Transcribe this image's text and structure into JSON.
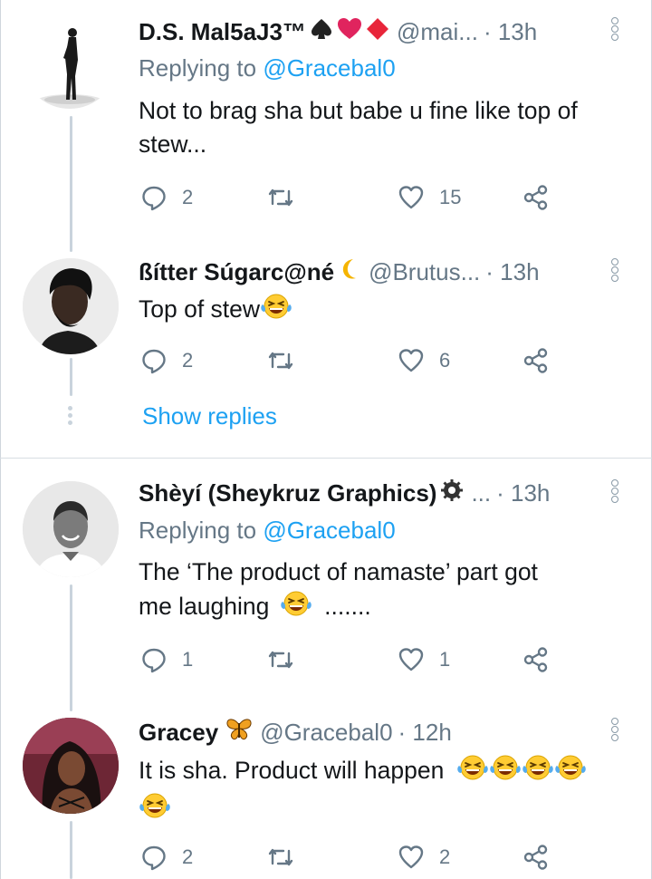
{
  "tweets": [
    {
      "name": "D.S. Mal5aJ3™",
      "name_emojis": [
        "spade",
        "heart",
        "diamond"
      ],
      "handle": "@mai...",
      "time": "· 13h",
      "replying_prefix": "Replying to",
      "replying_handle": "@Gracebal0",
      "text": "Not to brag sha but babe u fine like top of stew...",
      "replies": "2",
      "retweets": "",
      "likes": "15"
    },
    {
      "name": "ßítter Súgarc@né",
      "name_emojis": [
        "crescent-moon"
      ],
      "handle": "@Brutus...",
      "time": "· 13h",
      "text": "Top of stew",
      "text_emojis": [
        "laughing-tears"
      ],
      "replies": "2",
      "retweets": "",
      "likes": "6",
      "show_replies": "Show replies"
    },
    {
      "name": "Shèyí (Sheykruz Graphics)",
      "name_emojis": [
        "gear-badge"
      ],
      "handle": "...",
      "time": "· 13h",
      "replying_prefix": "Replying to",
      "replying_handle": "@Gracebal0",
      "text_line1": "The ‘The product of namaste’ part got",
      "text_line2_a": "me laughing",
      "text_line2_b": ".......",
      "text_emojis": [
        "laughing-tears"
      ],
      "replies": "1",
      "retweets": "",
      "likes": "1"
    },
    {
      "name": "Gracey",
      "name_emojis": [
        "butterfly"
      ],
      "handle": "@Gracebal0",
      "time": "· 12h",
      "text": "It is sha. Product will happen",
      "text_emojis": [
        "laughing-tears",
        "laughing-tears",
        "laughing-tears",
        "laughing-tears",
        "laughing-tears"
      ],
      "replies": "2",
      "retweets": "",
      "likes": "2"
    }
  ],
  "icons": {
    "reply": "reply-icon",
    "retweet": "retweet-icon",
    "like": "like-icon",
    "share": "share-icon",
    "more": "more-vertical-icon"
  },
  "colors": {
    "link": "#1da1f2",
    "muted": "#657786",
    "text": "#14171a",
    "emoji_face": "#ffcc33",
    "heart": "#e0245e",
    "diamond": "#e8253a"
  }
}
